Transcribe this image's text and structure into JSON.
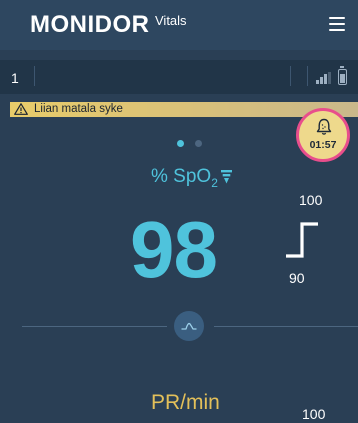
{
  "header": {
    "brand": "MONIDOR",
    "brand_sub": "Vitals",
    "menu_icon": "hamburger-menu-icon"
  },
  "status_bar": {
    "patient_number": "1",
    "signal_icon": "signal-strength-icon",
    "battery_icon": "battery-icon"
  },
  "alarm": {
    "message": "Liian matala syke",
    "icon": "warning-triangle-icon",
    "timer": "01:57",
    "timer_icon": "alarm-bell-icon",
    "banner_color": "#e8cc6a",
    "timer_border_color": "#e84e8c"
  },
  "pagination": {
    "count": 2,
    "active": 0
  },
  "spo2": {
    "label_prefix": "% SpO",
    "label_sub": "2",
    "value": "98",
    "high_limit": "100",
    "low_limit": "90",
    "color": "#4fc3dc",
    "filter_icon": "filter-icon",
    "limit_icon": "alarm-limits-step-icon"
  },
  "waveform_button": {
    "icon": "waveform-icon"
  },
  "pr": {
    "label": "PR/min",
    "high_limit": "100",
    "color": "#e3c05a"
  }
}
